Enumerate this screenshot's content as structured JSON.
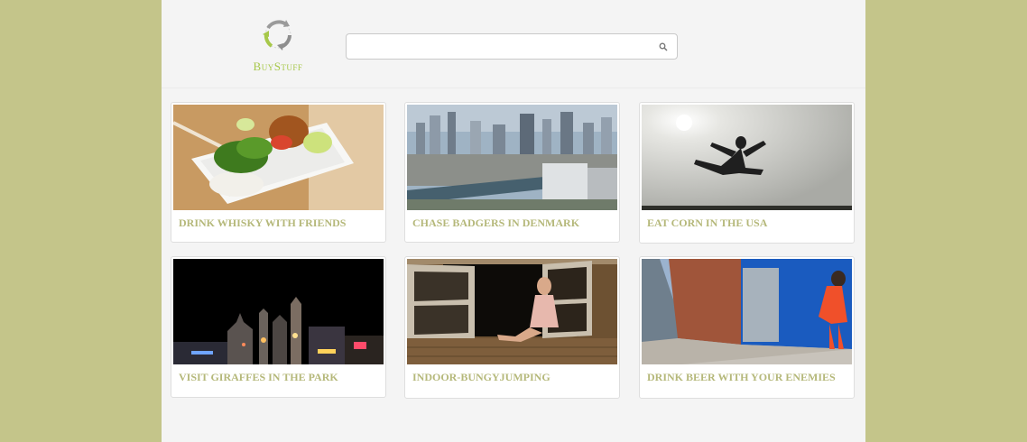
{
  "header": {
    "logo_text": "BuyStuff",
    "search": {
      "value": "",
      "placeholder": ""
    }
  },
  "cards": [
    {
      "title": "DRINK WHISKY WITH FRIENDS",
      "image": "bento-lunch-box-photo"
    },
    {
      "title": "CHASE BADGERS IN DENMARK",
      "image": "city-skyline-photo"
    },
    {
      "title": "EAT CORN IN THE USA",
      "image": "jump-kick-silhouette-photo"
    },
    {
      "title": "VISIT GIRAFFES IN THE PARK",
      "image": "night-city-lights-photo"
    },
    {
      "title": "INDOOR-BUNGYJUMPING",
      "image": "woman-in-window-photo"
    },
    {
      "title": "DRINK BEER WITH YOUR ENEMIES",
      "image": "woman-orange-dress-street-photo"
    }
  ],
  "colors": {
    "background": "#c4c58a",
    "page": "#f4f4f4",
    "title_text": "#b5b87a",
    "logo_green": "#a7c84a"
  }
}
